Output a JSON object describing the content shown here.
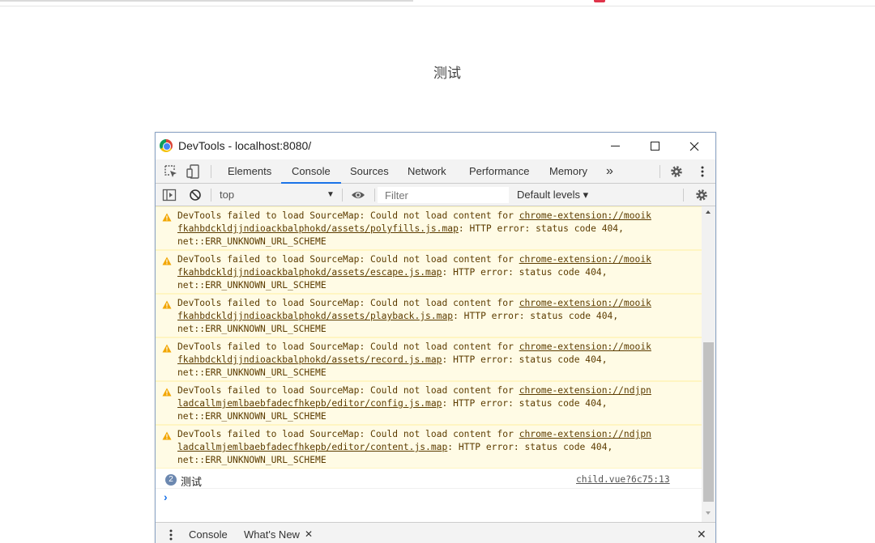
{
  "page": {
    "heading": "测试"
  },
  "devtools": {
    "window_title": "DevTools - localhost:8080/",
    "tabs": [
      {
        "label": "Elements"
      },
      {
        "label": "Console",
        "active": true
      },
      {
        "label": "Sources"
      },
      {
        "label": "Network"
      },
      {
        "label": "Performance"
      },
      {
        "label": "Memory"
      }
    ],
    "more_tabs_symbol": "»",
    "context_selector": "top",
    "filter_placeholder": "Filter",
    "levels_label": "Default levels ▾",
    "messages": [
      {
        "prefix": "DevTools failed to load SourceMap: Could not load content for ",
        "link": "chrome-extension://mooikfkahbdckldjjndioackbalphokd/assets/polyfills.js.map",
        "link_line1": "chrome-extension://mooik",
        "link_line2": "fkahbdckldjjndioackbalphokd/assets/polyfills.js.map",
        "suffix": ": HTTP error: status code 404,",
        "tail": "net::ERR_UNKNOWN_URL_SCHEME"
      },
      {
        "prefix": "DevTools failed to load SourceMap: Could not load content for ",
        "link": "chrome-extension://mooikfkahbdckldjjndioackbalphokd/assets/escape.js.map",
        "link_line1": "chrome-extension://mooik",
        "link_line2": "fkahbdckldjjndioackbalphokd/assets/escape.js.map",
        "suffix": ": HTTP error: status code 404,",
        "tail": "net::ERR_UNKNOWN_URL_SCHEME"
      },
      {
        "prefix": "DevTools failed to load SourceMap: Could not load content for ",
        "link": "chrome-extension://mooikfkahbdckldjjndioackbalphokd/assets/playback.js.map",
        "link_line1": "chrome-extension://mooik",
        "link_line2": "fkahbdckldjjndioackbalphokd/assets/playback.js.map",
        "suffix": ": HTTP error: status code 404,",
        "tail": "net::ERR_UNKNOWN_URL_SCHEME"
      },
      {
        "prefix": "DevTools failed to load SourceMap: Could not load content for ",
        "link": "chrome-extension://mooikfkahbdckldjjndioackbalphokd/assets/record.js.map",
        "link_line1": "chrome-extension://mooik",
        "link_line2": "fkahbdckldjjndioackbalphokd/assets/record.js.map",
        "suffix": ": HTTP error: status code 404,",
        "tail": "net::ERR_UNKNOWN_URL_SCHEME"
      },
      {
        "prefix": "DevTools failed to load SourceMap: Could not load content for ",
        "link": "chrome-extension://ndjpnladcallmjemlbaebfadecfhkepb/editor/config.js.map",
        "link_line1": "chrome-extension://ndjpn",
        "link_line2": "ladcallmjemlbaebfadecfhkepb/editor/config.js.map",
        "suffix": ": HTTP error: status code 404,",
        "tail": "net::ERR_UNKNOWN_URL_SCHEME"
      },
      {
        "prefix": "DevTools failed to load SourceMap: Could not load content for ",
        "link": "chrome-extension://ndjpnladcallmjemlbaebfadecfhkepb/editor/content.js.map",
        "link_line1": "chrome-extension://ndjpn",
        "link_line2": "ladcallmjemlbaebfadecfhkepb/editor/content.js.map",
        "suffix": ": HTTP error: status code 404,",
        "tail": "net::ERR_UNKNOWN_URL_SCHEME"
      }
    ],
    "log": {
      "count": "2",
      "text": "测试",
      "source": "child.vue?6c75:13"
    },
    "prompt_symbol": "›",
    "drawer_tabs": [
      {
        "label": "Console"
      },
      {
        "label": "What's New",
        "closable": true
      }
    ],
    "drawer_close_symbol": "✕",
    "close_symbol": "✕"
  },
  "colors": {
    "warning_bg": "#fffbe5",
    "warning_text": "#5c3c00",
    "active_tab_underline": "#1a73e8",
    "warning_icon": "#f2a600"
  }
}
